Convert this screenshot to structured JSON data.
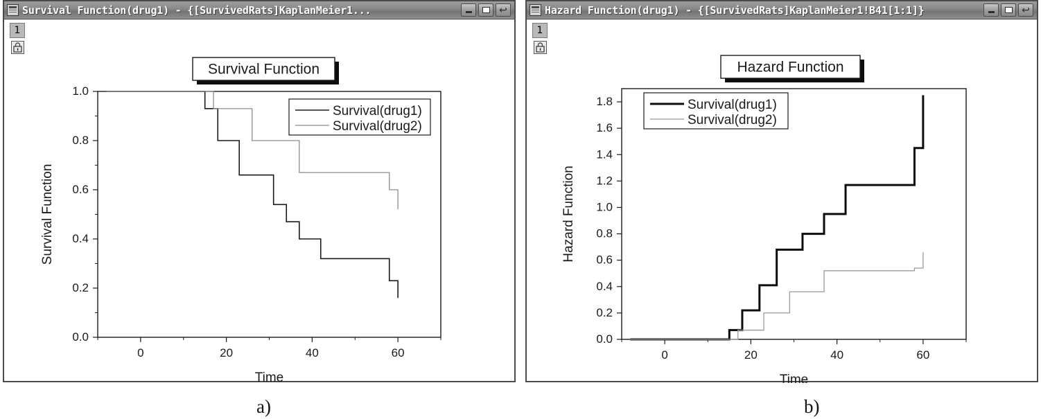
{
  "figure": {
    "caption_a": "a)",
    "caption_b": "b)"
  },
  "windows": [
    {
      "id": "survival",
      "title": "Survival Function(drug1) - {[SurvivedRats]KaplanMeier1...",
      "icon": "worksheet-icon",
      "layer_tab": "1",
      "lock_icon": "lock-icon",
      "buttons": [
        {
          "name": "minimize-button",
          "glyph": "_"
        },
        {
          "name": "maximize-button",
          "glyph": "□"
        },
        {
          "name": "restore-button",
          "glyph": "↵"
        }
      ]
    },
    {
      "id": "hazard",
      "title": "Hazard Function(drug1) - {[SurvivedRats]KaplanMeier1!B41[1:1]}",
      "icon": "worksheet-icon",
      "layer_tab": "1",
      "lock_icon": "lock-icon",
      "buttons": [
        {
          "name": "minimize-button",
          "glyph": "_"
        },
        {
          "name": "maximize-button",
          "glyph": "□"
        },
        {
          "name": "restore-button",
          "glyph": "↵"
        }
      ]
    }
  ],
  "chart_data": [
    {
      "type": "line",
      "panel": "a",
      "title": "Survival Function",
      "xlabel": "Time",
      "ylabel": "Survival Function",
      "xlim": [
        -10,
        70
      ],
      "ylim": [
        0.0,
        1.0
      ],
      "xticks": [
        0,
        20,
        40,
        60
      ],
      "xticklabels": [
        "0",
        "20",
        "40",
        "60"
      ],
      "xminorticks": [
        -10,
        10,
        30,
        50,
        70
      ],
      "yticks": [
        0.0,
        0.2,
        0.4,
        0.6,
        0.8,
        1.0
      ],
      "yticklabels": [
        "0.0",
        "0.2",
        "0.4",
        "0.6",
        "0.8",
        "1.0"
      ],
      "yminorticks": [
        0.1,
        0.3,
        0.5,
        0.7,
        0.9
      ],
      "grid": false,
      "legend_position": "upper-right",
      "series": [
        {
          "name": "Survival(drug1)",
          "color": "#1a1a1a",
          "width": 1.6,
          "step": "post",
          "x": [
            -8,
            14,
            15,
            17,
            18,
            20,
            23,
            26,
            31,
            32,
            34,
            37,
            42,
            58,
            60
          ],
          "y": [
            1.0,
            1.0,
            0.93,
            0.93,
            0.8,
            0.8,
            0.66,
            0.66,
            0.54,
            0.54,
            0.47,
            0.4,
            0.32,
            0.23,
            0.16
          ]
        },
        {
          "name": "Survival(drug2)",
          "color": "#8d8d8d",
          "width": 1.3,
          "step": "post",
          "x": [
            -8,
            15,
            17,
            23,
            26,
            29,
            37,
            58,
            60
          ],
          "y": [
            1.0,
            1.0,
            0.93,
            0.93,
            0.8,
            0.8,
            0.67,
            0.6,
            0.52
          ]
        }
      ]
    },
    {
      "type": "line",
      "panel": "b",
      "title": "Hazard Function",
      "xlabel": "Time",
      "ylabel": "Hazard Function",
      "xlim": [
        -10,
        70
      ],
      "ylim": [
        0.0,
        1.9
      ],
      "xticks": [
        0,
        20,
        40,
        60
      ],
      "xticklabels": [
        "0",
        "20",
        "40",
        "60"
      ],
      "xminorticks": [
        -10,
        10,
        30,
        50,
        70
      ],
      "yticks": [
        0.0,
        0.2,
        0.4,
        0.6,
        0.8,
        1.0,
        1.2,
        1.4,
        1.6,
        1.8
      ],
      "yticklabels": [
        "0.0",
        "0.2",
        "0.4",
        "0.6",
        "0.8",
        "1.0",
        "1.2",
        "1.4",
        "1.6",
        "1.8"
      ],
      "grid": false,
      "legend_position": "upper-left",
      "series": [
        {
          "name": "Survival(drug1)",
          "color": "#0d0d0d",
          "width": 3.0,
          "step": "post",
          "x": [
            -8,
            14,
            15,
            17,
            18,
            20,
            22,
            23,
            26,
            31,
            32,
            37,
            42,
            58,
            60
          ],
          "y": [
            0.0,
            0.0,
            0.07,
            0.07,
            0.22,
            0.22,
            0.41,
            0.41,
            0.68,
            0.68,
            0.8,
            0.95,
            1.17,
            1.45,
            1.85
          ]
        },
        {
          "name": "Survival(drug2)",
          "color": "#9a9a9a",
          "width": 1.3,
          "step": "post",
          "x": [
            -8,
            15,
            17,
            20,
            23,
            26,
            29,
            32,
            37,
            58,
            60
          ],
          "y": [
            0.0,
            0.0,
            0.07,
            0.07,
            0.2,
            0.2,
            0.36,
            0.36,
            0.52,
            0.54,
            0.66
          ]
        }
      ]
    }
  ]
}
